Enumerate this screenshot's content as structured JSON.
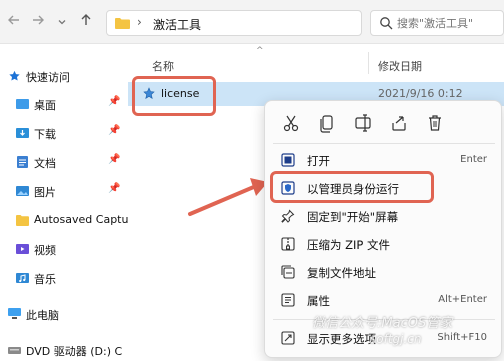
{
  "toolbar": {
    "back_icon": "arrow-left-icon",
    "forward_icon": "arrow-right-icon",
    "recent_icon": "chevron-down-icon",
    "up_icon": "arrow-up-icon"
  },
  "address": {
    "separator": "›",
    "folder": "激活工具"
  },
  "search": {
    "placeholder": "搜索\"激活工具\""
  },
  "sidebar": {
    "items": [
      {
        "label": "快速访问",
        "icon": "star-icon",
        "pinned": false
      },
      {
        "label": "桌面",
        "icon": "desktop-icon",
        "pinned": true
      },
      {
        "label": "下载",
        "icon": "download-icon",
        "pinned": true
      },
      {
        "label": "文档",
        "icon": "document-icon",
        "pinned": true
      },
      {
        "label": "图片",
        "icon": "pictures-icon",
        "pinned": true
      },
      {
        "label": "Autosaved Captu",
        "icon": "folder-icon",
        "pinned": false
      },
      {
        "label": "视频",
        "icon": "video-icon",
        "pinned": false
      },
      {
        "label": "音乐",
        "icon": "music-icon",
        "pinned": false
      },
      {
        "label": "此电脑",
        "icon": "computer-icon",
        "pinned": false
      },
      {
        "label": "DVD 驱动器 (D:) C",
        "icon": "dvd-icon",
        "pinned": false
      }
    ],
    "pin_glyph": "📌"
  },
  "list": {
    "col_name": "名称",
    "col_date": "修改日期",
    "sort_glyph": "^",
    "file": {
      "name": "license",
      "date": "2021/9/16 0:12"
    }
  },
  "menu": {
    "quick_actions": [
      "cut-icon",
      "copy-icon",
      "rename-icon",
      "share-icon",
      "delete-icon"
    ],
    "items": [
      {
        "label": "打开",
        "shortcut": "Enter",
        "icon": "open-icon"
      },
      {
        "label": "以管理员身份运行",
        "shortcut": "",
        "icon": "shield-icon"
      },
      {
        "label": "固定到\"开始\"屏幕",
        "shortcut": "",
        "icon": "pin-icon"
      },
      {
        "label": "压缩为 ZIP 文件",
        "shortcut": "",
        "icon": "zip-icon"
      },
      {
        "label": "复制文件地址",
        "shortcut": "",
        "icon": "copy-path-icon"
      },
      {
        "label": "属性",
        "shortcut": "Alt+Enter",
        "icon": "properties-icon"
      },
      {
        "label": "显示更多选项",
        "shortcut": "Shift+F10",
        "icon": "more-options-icon"
      }
    ]
  },
  "watermark": {
    "line1": "微信公众号:MacOS管家",
    "line2": "softgj.cn"
  },
  "colors": {
    "highlight": "#e06452",
    "selection": "#cce4f7",
    "folder": "#f4c442"
  }
}
